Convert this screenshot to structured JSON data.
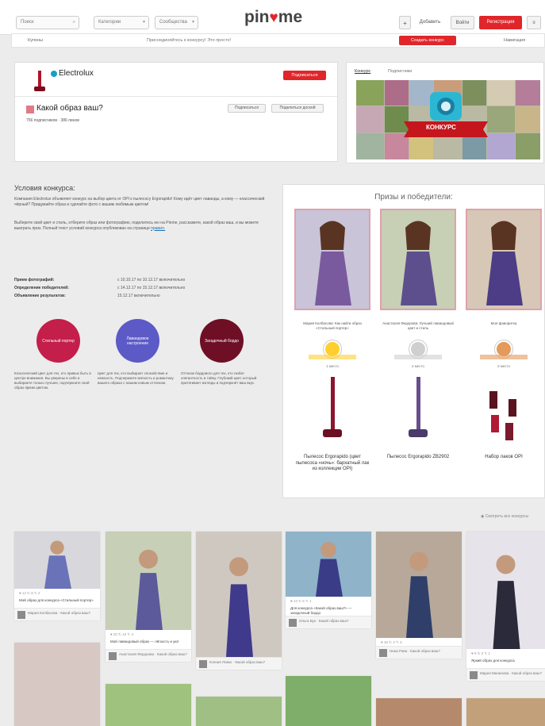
{
  "header": {
    "search_placeholder": "Поиск",
    "category_label": "Категории",
    "sort_label": "Сообщества",
    "logo_left": "pin",
    "logo_heart": "♥",
    "logo_right": "me",
    "add_label": "Добавить",
    "login_label": "Войти",
    "register_label": "Регистрация"
  },
  "subbar": {
    "left": "Купоны",
    "center": "Присоединяйтесь к конкурсу! Это просто!",
    "button": "Создать конкурс",
    "right": "Навигация"
  },
  "brand": {
    "name": "Electrolux",
    "follow_button": "Подписаться"
  },
  "board": {
    "title": "Какой образ ваш?",
    "meta": "756 подписчиков · 386 пинов",
    "btn_follow": "Подписаться",
    "btn_share": "Поделиться доской"
  },
  "banner": {
    "tab_active": "Конкурс",
    "tab_other": "Подписчики",
    "label": "КОНКУРС"
  },
  "conditions": {
    "heading": "Условия конкурса:",
    "para1": "Компания Electrolux объявляет конкурс на выбор цвета от OPI к пылесосу Ergorapido! Кому идёт цвет лаванды, а кому — классический чёрный? Придумайте образ и сделайте фото с вашим любимым цветом!",
    "para2": "Выберите свой цвет и стиль, отберите образ или фотографию, поделитесь ею на Pinme, расскажите, какой образ ваш, и вы можете выиграть приз. Полный текст условий конкурса опубликован на странице",
    "para2_link": "правил.",
    "dates": [
      {
        "label": "Прием фотографий:",
        "value": "с 10.10.17 по 10.12.17 включительно"
      },
      {
        "label": "Определение победителей:",
        "value": "с 14.12.17 по 15.12.17 включительно"
      },
      {
        "label": "Объявление результатов:",
        "value": "15.12.17 включительно"
      }
    ],
    "circles": [
      {
        "label": "Стильный портер",
        "color": "#c41e4b",
        "text": "Классический цвет для тех, кто привык быть в центре внимания. Вы уверены в себе и выбираете только лучшее, подчеркните свой образ ярким цветом."
      },
      {
        "label": "Лавандовое настроение",
        "color": "#5c5ac7",
        "text": "Цвет для тех, кто выбирает спокойствие и нежность. Подчеркните мягкость и романтику вашего образа с нашим новым оттенком."
      },
      {
        "label": "Загадочный бордо",
        "color": "#6e0f25",
        "text": "Оттенок бордового для тех, кто любит элегантность и тайну. Глубокий цвет, который притягивает взгляды и подчеркнёт ваш вкус."
      }
    ]
  },
  "prizes": {
    "heading": "Призы и победители:",
    "winners": [
      {
        "caption": "Мария Колбасова: Как найти образ «Стильный портер»",
        "color": "#ffcf2e",
        "place": "1 место",
        "prize": "Пылесос Ergorapido (цвет пылесоса «ночь»: бархатный лак из коллекции OPI)"
      },
      {
        "caption": "Анастасия Федорова: Лучший лавандовый цвет и стиль",
        "color": "#cfcfcf",
        "place": "2 место",
        "prize": "Пылесос Ergorapido ZB2902"
      },
      {
        "caption": "Моя фаворитка",
        "color": "#e39a5a",
        "place": "3 место",
        "prize": "Набор лаков OPI"
      }
    ]
  },
  "feed": {
    "more_link": "Смотреть все конкурсы",
    "pins": [
      {
        "stats": "♥ 14  ↻ 8  ✎ 2",
        "text": "Мой образ для конкурса «Стильный портер»",
        "author": "Мария Колбасова · Какой образ ваш?"
      },
      {
        "stats": "♥ 20  ↻ 10  ✎ 4",
        "text": "Мой лавандовый образ — лёгкость и уют",
        "author": "Анастасия Федорова · Какой образ ваш?"
      },
      {
        "stats": "",
        "text": "",
        "author": "Ксения Ловко · Какой образ ваш?"
      },
      {
        "stats": "♥ 12  ↻ 6  ✎ 1",
        "text": "Для конкурса «Какой образ ваш?» — загадочный бордо",
        "author": "Ольга Бук · Какой образ ваш?"
      },
      {
        "stats": "♥ 18  ↻ 4  ✎ 3",
        "text": "",
        "author": "Нина Рова · Какой образ ваш?"
      },
      {
        "stats": "♥ 9  ↻ 2  ✎ 1",
        "text": "Яркий образ для конкурса",
        "author": "Мария Малинова · Какой образ ваш?"
      }
    ]
  }
}
